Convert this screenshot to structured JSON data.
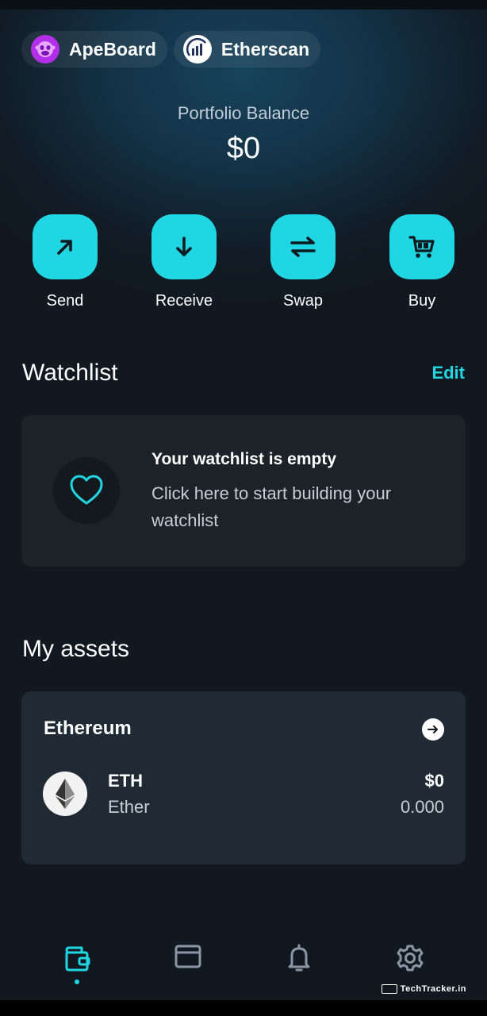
{
  "chips": [
    {
      "label": "ApeBoard",
      "icon": "ape-face-icon",
      "color": "#b22ee8"
    },
    {
      "label": "Etherscan",
      "icon": "etherscan-chart-icon",
      "color": "#ffffff"
    }
  ],
  "portfolio": {
    "label": "Portfolio Balance",
    "value": "$0"
  },
  "actions": [
    {
      "label": "Send",
      "icon": "arrow-up-right-icon"
    },
    {
      "label": "Receive",
      "icon": "arrow-down-icon"
    },
    {
      "label": "Swap",
      "icon": "swap-arrows-icon"
    },
    {
      "label": "Buy",
      "icon": "cart-icon"
    }
  ],
  "watchlist": {
    "title": "Watchlist",
    "edit": "Edit",
    "empty_title": "Your watchlist is empty",
    "empty_subtitle": "Click here to start building your watchlist"
  },
  "assets": {
    "title": "My assets",
    "chain": "Ethereum",
    "items": [
      {
        "symbol": "ETH",
        "name": "Ether",
        "value": "$0",
        "amount": "0.000"
      }
    ]
  },
  "nav": [
    "wallet-icon",
    "browser-icon",
    "bell-icon",
    "settings-icon"
  ],
  "watermark": "TechTracker.in",
  "colors": {
    "accent": "#1fd6e2",
    "background": "#111820",
    "card": "#1c2228"
  }
}
